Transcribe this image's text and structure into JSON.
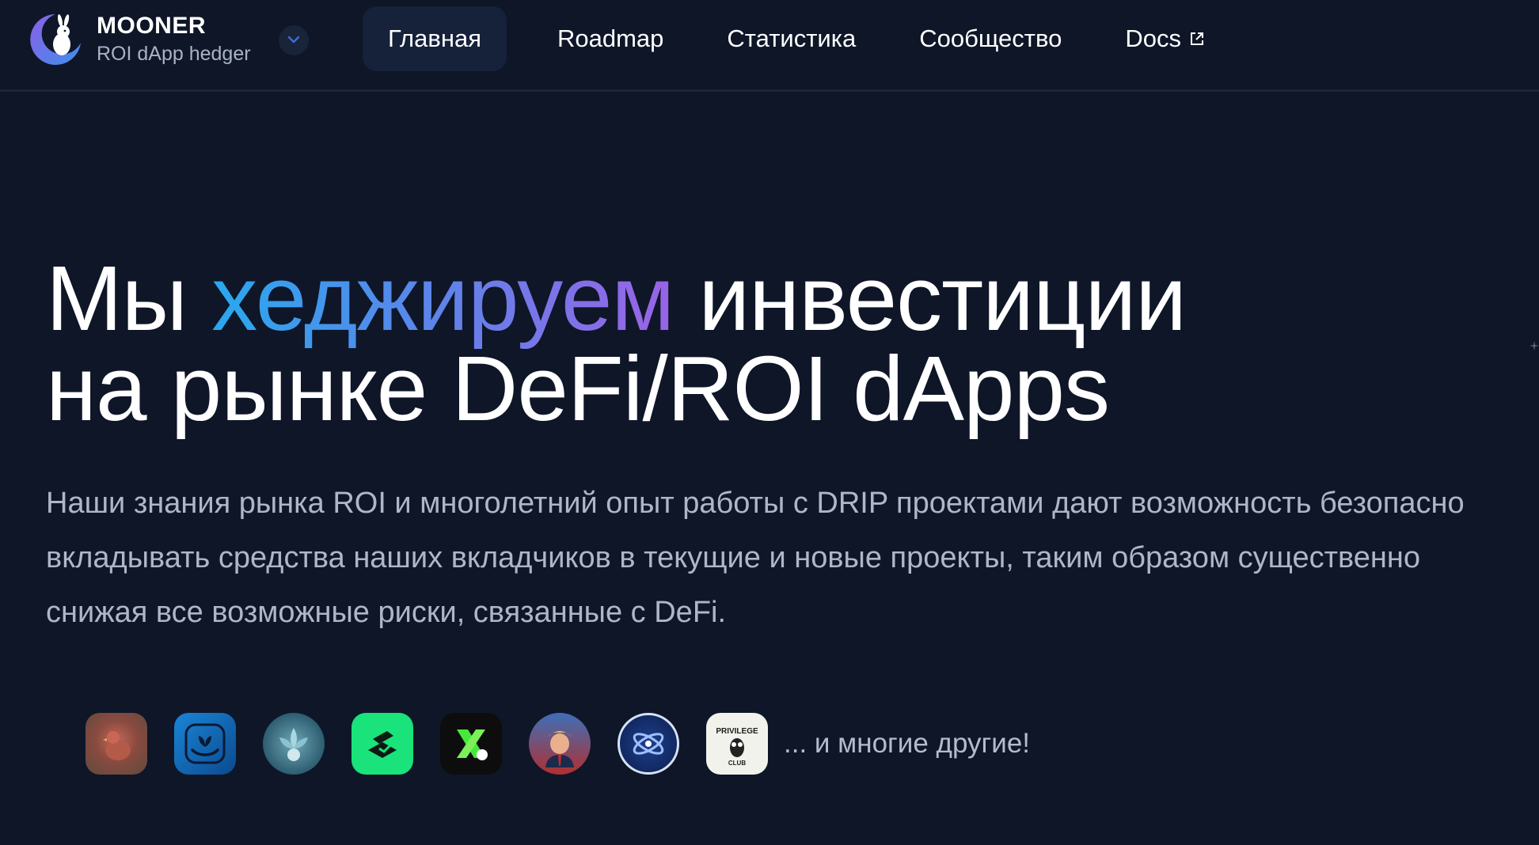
{
  "brand": {
    "name": "MOONER",
    "subtitle": "ROI dApp hedger",
    "logo_icon": "moon-rabbit-icon",
    "toggle_icon": "chevron-down-icon"
  },
  "nav": {
    "items": [
      {
        "label": "Главная",
        "active": true
      },
      {
        "label": "Roadmap"
      },
      {
        "label": "Статистика"
      },
      {
        "label": "Сообщество"
      },
      {
        "label": "Docs",
        "icon": "external-link-icon"
      }
    ]
  },
  "hero": {
    "title_part1": "Мы ",
    "title_highlight": "хеджируем",
    "title_part2": " инвестиции",
    "title_line2": "на рынке DeFi/ROI dApps",
    "description": "Наши знания рынка ROI и многолетний опыт работы с DRIP проектами дают возможность безопасно вкладывать средства наших вкладчиков в текущие и новые проекты, таким образом существенно снижая все возможные риски, связанные с DeFi."
  },
  "partners": {
    "icons": [
      "chicken-icon",
      "hand-plant-icon",
      "blue-flower-icon",
      "green-printer-icon",
      "x-logo-icon",
      "trump-portrait-icon",
      "atom-logo-icon",
      "privilege-club-owl-icon"
    ],
    "badge_text": "PRIVILEGE",
    "badge_sub": "CLUB",
    "more_label": "... и многие другие!"
  },
  "colors": {
    "background": "#0e1628",
    "nav_active": "#16213a",
    "gradient_start": "#2aa8ee",
    "gradient_end": "#9a63e6",
    "muted_text": "#aeb7c7"
  }
}
